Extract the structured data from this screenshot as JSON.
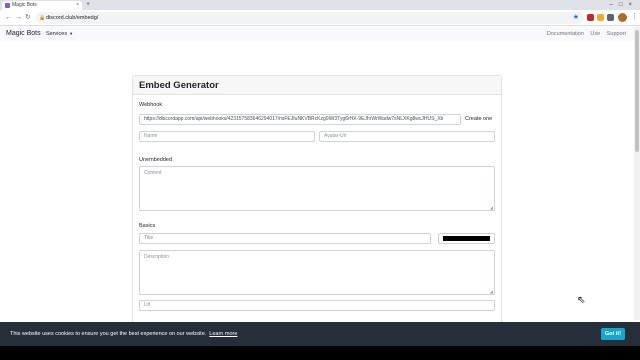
{
  "browser": {
    "tab_title": "Magic Bots",
    "tab_close": "×",
    "new_tab": "+",
    "window_controls": "–□×",
    "back": "←",
    "forward": "→",
    "reload": "↻",
    "url": "discord.club/embedg/",
    "lock": "🔒",
    "star": "★",
    "menu": "⋮"
  },
  "navbar": {
    "brand": "Magic Bots",
    "services": "Services",
    "links": [
      "Documentation",
      "Use",
      "Support"
    ]
  },
  "card": {
    "title": "Embed Generator",
    "webhook": {
      "label": "Webhook",
      "value": "https://discordapp.com/api/webhooks/423157583646294017/nsFEJfuNKVBRcKzg0iW3Tyg6rHX-9EJhrWrWadw7sNLXKg8wcJHUS_Xb",
      "create": "Create one"
    },
    "name_placeholder": "Name",
    "avatar_placeholder": "Avatar-Url",
    "unembedded": {
      "label": "Unembedded",
      "content_placeholder": "Content"
    },
    "basics": {
      "label": "Basics",
      "title_placeholder": "Title",
      "color": "#000000",
      "description_placeholder": "Description",
      "url_placeholder": "Url"
    }
  },
  "cookie": {
    "message": "This website uses cookies to ensure you get the best experience on our website.",
    "learn_more": "Learn more",
    "button": "Got it!"
  },
  "colors": {
    "cookie_bg": "#252e39",
    "cookie_button": "#14a7d0",
    "embed_color": "#000000"
  }
}
